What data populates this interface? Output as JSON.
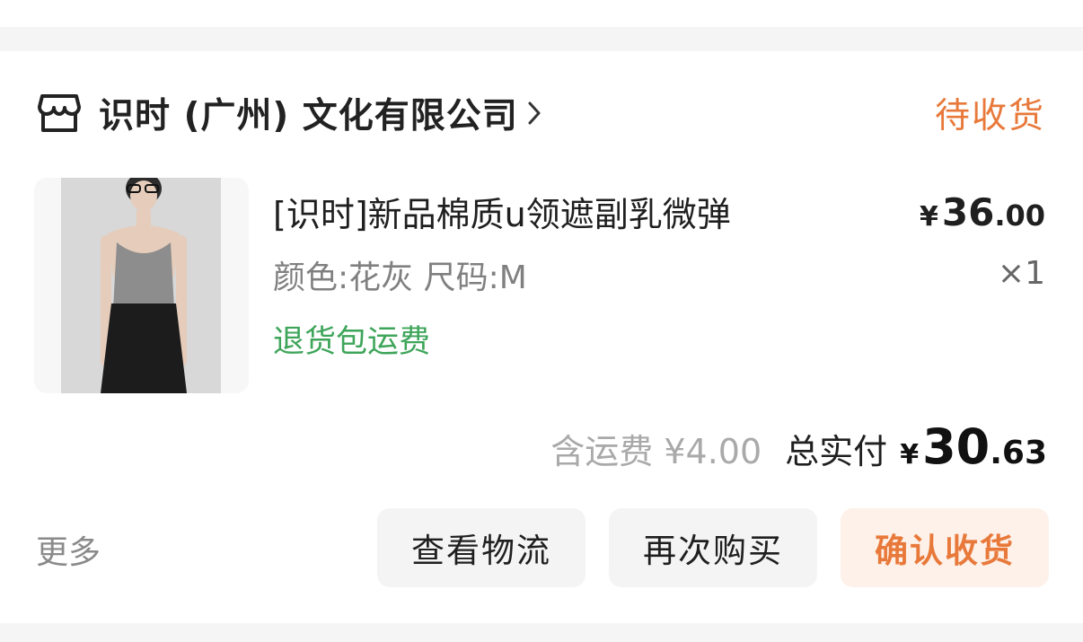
{
  "store": {
    "name": "识时 (广州) 文化有限公司",
    "icon": "store-icon",
    "status": "待收货"
  },
  "product": {
    "title": "[识时]新品棉质u领遮副乳微弹",
    "spec": "颜色:花灰 尺码:M",
    "tag": "退货包运费",
    "unit_price": {
      "currency": "¥",
      "integer": "36",
      "decimal": ".00"
    },
    "quantity": "×1"
  },
  "summary": {
    "shipping": "含运费 ¥4.00",
    "total_label": "总实付",
    "total_price": {
      "currency": "¥",
      "integer": "30",
      "decimal": ".63"
    }
  },
  "actions": {
    "more": "更多",
    "logistics": "查看物流",
    "rebuy": "再次购买",
    "confirm": "确认收货"
  },
  "colors": {
    "accent": "#e8793a",
    "tag_green": "#3ea55a",
    "button_bg": "#f4f4f4",
    "accent_bg": "#fdf1e9"
  }
}
